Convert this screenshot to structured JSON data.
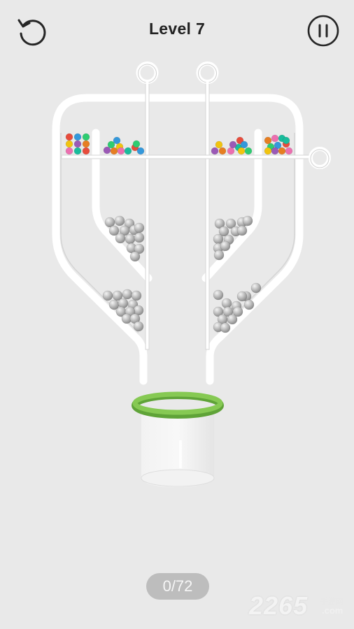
{
  "header": {
    "level_title": "Level 7",
    "restart_icon": "restart-arrow-icon",
    "pause_icon": "pause-icon"
  },
  "game": {
    "balls_collected": "0/72",
    "pins": [
      "left-vertical-pin",
      "right-vertical-pin",
      "horizontal-pin"
    ],
    "colored_ball_palette": [
      "#e74c3c",
      "#3498db",
      "#2ecc71",
      "#f1c40f",
      "#9b59b6",
      "#e67e22",
      "#ec6fb0",
      "#1abc9c"
    ],
    "gray_ball_color": "#b8b8b8",
    "cup_rim_color": "#7cc24a"
  },
  "watermark": {
    "number": "2265",
    "cn_text": "手游网",
    "domain": ".com"
  }
}
